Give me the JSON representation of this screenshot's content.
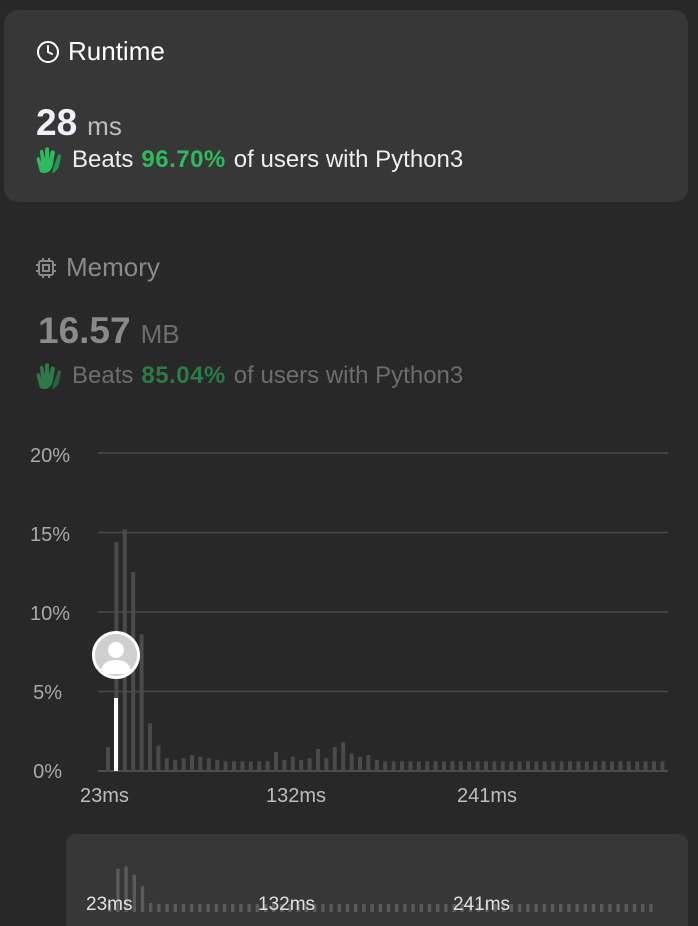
{
  "runtime": {
    "title": "Runtime",
    "value": "28",
    "unit": "ms",
    "beats_label": "Beats",
    "beats_pct": "96.70%",
    "beats_suffix": "of users with Python3"
  },
  "memory": {
    "title": "Memory",
    "value": "16.57",
    "unit": "MB",
    "beats_label": "Beats",
    "beats_pct": "85.04%",
    "beats_suffix": "of users with Python3"
  },
  "icons": {
    "runtime": "clock-icon",
    "memory": "chip-icon",
    "beats": "clap-icon",
    "marker": "user-avatar-icon"
  },
  "colors": {
    "accent_green": "#2cbb5d",
    "bar": "#4a4a4a",
    "marker": "#ffffff"
  },
  "chart_data": {
    "type": "bar",
    "y_ticks": [
      "20%",
      "15%",
      "10%",
      "5%",
      "0%"
    ],
    "ylim": [
      0,
      20
    ],
    "x_ticks": [
      "23ms",
      "132ms",
      "241ms"
    ],
    "x_tick_values": [
      23,
      132,
      241
    ],
    "marker_x": 28,
    "grid": true,
    "series": [
      {
        "values": [
          1.5,
          14.4,
          15.2,
          12.5,
          8.6,
          3.0,
          1.6,
          0.8,
          0.7,
          0.8,
          1.0,
          0.9,
          0.8,
          0.7,
          0.6,
          0.6,
          0.6,
          0.6,
          0.6,
          0.6,
          1.2,
          0.7,
          0.9,
          0.7,
          0.8,
          1.4,
          0.8,
          1.5,
          1.8,
          1.1,
          0.9,
          1.0,
          0.7,
          0.6,
          0.6,
          0.6,
          0.6,
          0.6,
          0.6,
          0.6,
          0.6,
          0.6,
          0.6,
          0.6,
          0.6,
          0.6,
          0.6,
          0.6,
          0.6,
          0.6,
          0.6,
          0.6,
          0.6,
          0.6,
          0.6,
          0.6,
          0.6,
          0.6,
          0.6,
          0.6,
          0.6,
          0.6,
          0.6,
          0.6,
          0.6,
          0.6,
          0.6
        ]
      }
    ]
  },
  "mini_chart": {
    "x_ticks": [
      "23ms",
      "132ms",
      "241ms"
    ]
  }
}
